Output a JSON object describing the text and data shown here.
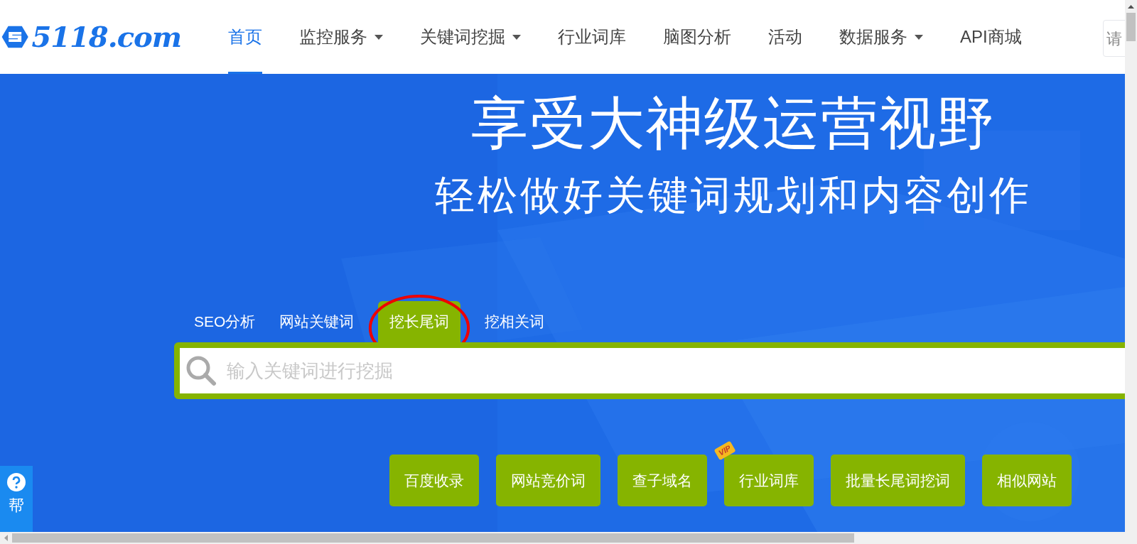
{
  "logo": {
    "text": "5118.com"
  },
  "nav": [
    {
      "label": "首页",
      "selected": true,
      "dropdown": false
    },
    {
      "label": "监控服务",
      "selected": false,
      "dropdown": true
    },
    {
      "label": "关键词挖掘",
      "selected": false,
      "dropdown": true
    },
    {
      "label": "行业词库",
      "selected": false,
      "dropdown": false
    },
    {
      "label": "脑图分析",
      "selected": false,
      "dropdown": false
    },
    {
      "label": "活动",
      "selected": false,
      "dropdown": false
    },
    {
      "label": "数据服务",
      "selected": false,
      "dropdown": true
    },
    {
      "label": "API商城",
      "selected": false,
      "dropdown": false
    }
  ],
  "header_search": {
    "placeholder": "请"
  },
  "hero": {
    "title": "享受大神级运营视野",
    "subtitle": "轻松做好关键词规划和内容创作"
  },
  "search_tabs": [
    {
      "label": "SEO分析",
      "selected": false,
      "circled": false
    },
    {
      "label": "网站关键词",
      "selected": false,
      "circled": false
    },
    {
      "label": "挖长尾词",
      "selected": true,
      "circled": true
    },
    {
      "label": "挖相关词",
      "selected": false,
      "circled": false
    }
  ],
  "search": {
    "placeholder": "输入关键词进行挖掘"
  },
  "quick_links": [
    {
      "label": "百度收录"
    },
    {
      "label": "网站竞价词"
    },
    {
      "label": "查子域名"
    },
    {
      "label": "行业词库",
      "badge": "VIP"
    },
    {
      "label": "批量长尾词挖词"
    },
    {
      "label": "相似网站"
    }
  ],
  "help": {
    "label": "帮"
  }
}
